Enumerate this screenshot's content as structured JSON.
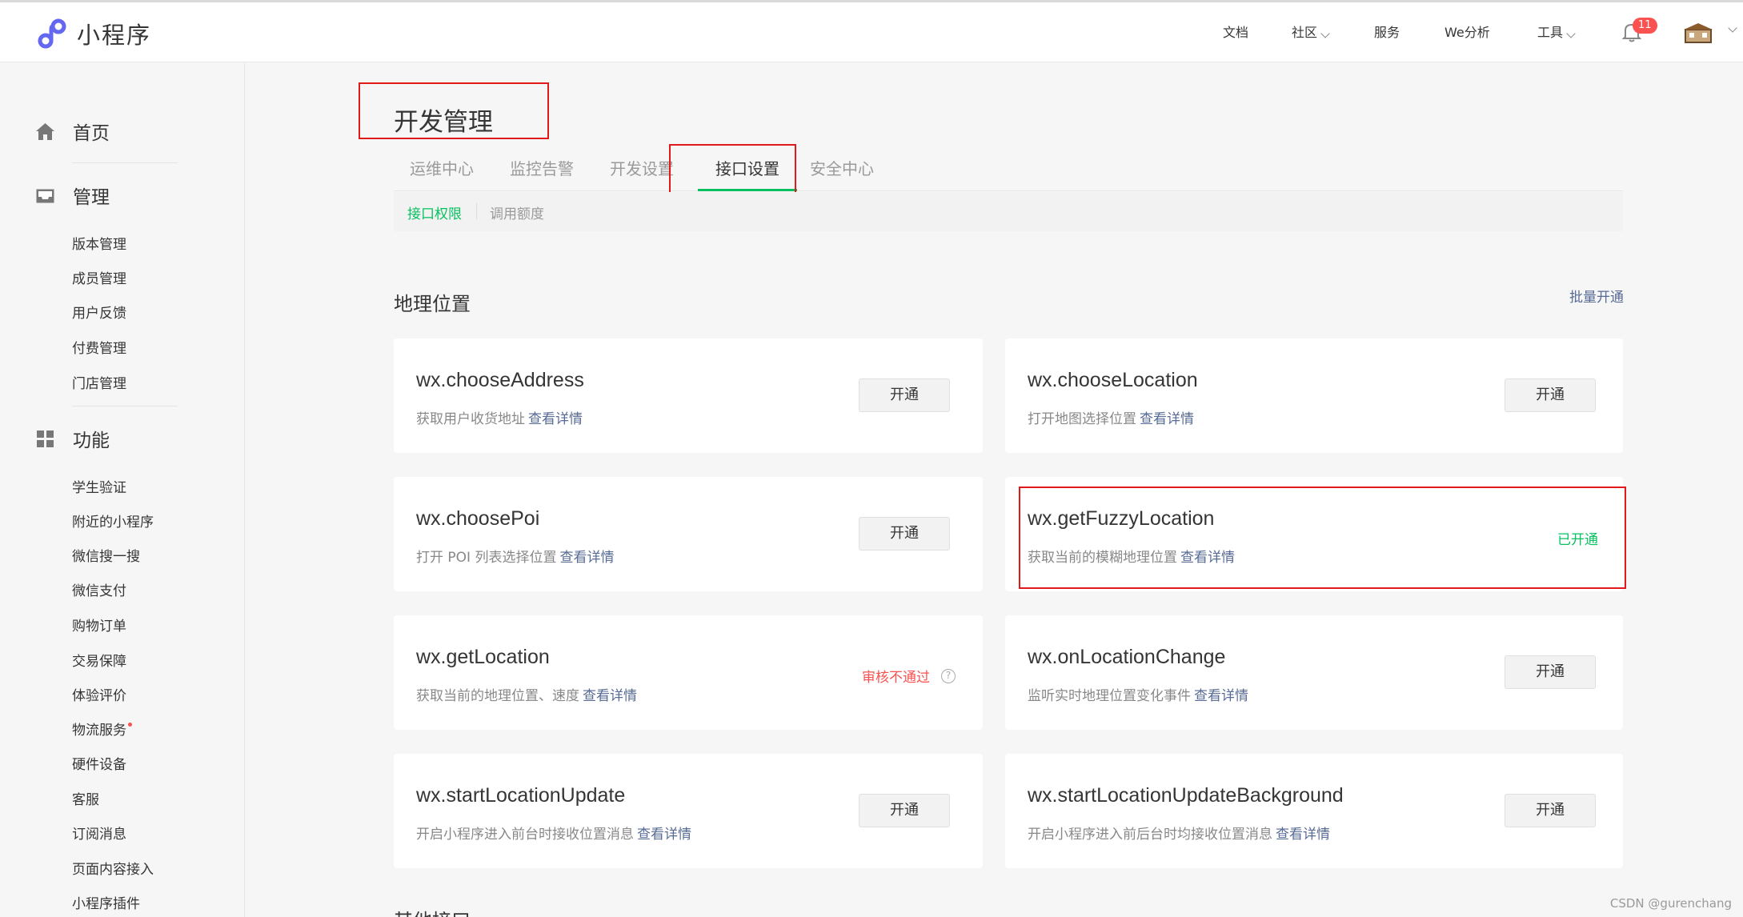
{
  "app": {
    "logo_text": "小程序"
  },
  "topnav": {
    "docs": "文档",
    "community": "社区",
    "service": "服务",
    "we_analysis": "We分析",
    "tools": "工具",
    "notification_count": "11"
  },
  "sidebar": {
    "home": "首页",
    "manage": "管理",
    "manage_items": [
      "版本管理",
      "成员管理",
      "用户反馈",
      "付费管理",
      "门店管理"
    ],
    "features": "功能",
    "feature_items": [
      "学生验证",
      "附近的小程序",
      "微信搜一搜",
      "微信支付",
      "购物订单",
      "交易保障",
      "体验评价",
      "物流服务",
      "硬件设备",
      "客服",
      "订阅消息",
      "页面内容接入",
      "小程序插件"
    ]
  },
  "page": {
    "title": "开发管理",
    "tabs": [
      "运维中心",
      "监控告警",
      "开发设置",
      "接口设置",
      "安全中心"
    ],
    "subtabs": [
      "接口权限",
      "调用额度"
    ],
    "section_title": "地理位置",
    "batch_enable": "批量开通",
    "other_title": "其他接口",
    "view_details": "查看详情",
    "enable_label": "开通",
    "enabled_label": "已开通",
    "rejected_label": "审核不通过"
  },
  "apis": [
    {
      "name": "wx.chooseAddress",
      "desc": "获取用户收货地址"
    },
    {
      "name": "wx.chooseLocation",
      "desc": "打开地图选择位置"
    },
    {
      "name": "wx.choosePoi",
      "desc": "打开 POI 列表选择位置"
    },
    {
      "name": "wx.getFuzzyLocation",
      "desc": "获取当前的模糊地理位置"
    },
    {
      "name": "wx.getLocation",
      "desc": "获取当前的地理位置、速度"
    },
    {
      "name": "wx.onLocationChange",
      "desc": "监听实时地理位置变化事件"
    },
    {
      "name": "wx.startLocationUpdate",
      "desc": "开启小程序进入前台时接收位置消息"
    },
    {
      "name": "wx.startLocationUpdateBackground",
      "desc": "开启小程序进入前后台时均接收位置消息"
    }
  ],
  "watermark": "CSDN @gurenchang"
}
